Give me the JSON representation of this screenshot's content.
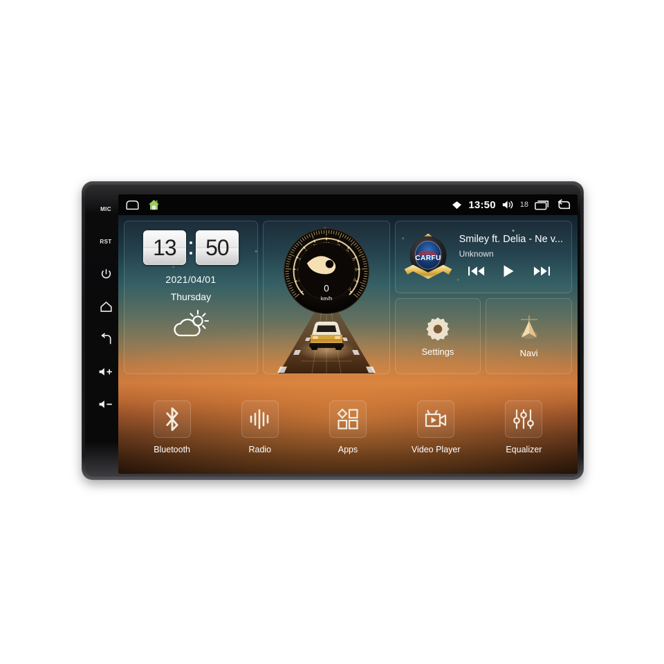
{
  "device": {
    "hard_keys": [
      {
        "name": "mic-key",
        "label": "MIC",
        "type": "text"
      },
      {
        "name": "reset-key",
        "label": "RST",
        "type": "text"
      },
      {
        "name": "power-key",
        "label": "power-icon",
        "type": "icon"
      },
      {
        "name": "home-key",
        "label": "home-icon",
        "type": "icon"
      },
      {
        "name": "back-key",
        "label": "back-icon",
        "type": "icon"
      },
      {
        "name": "volume-up-key",
        "label": "volume-up-icon",
        "type": "icon"
      },
      {
        "name": "volume-down-key",
        "label": "volume-down-icon",
        "type": "icon"
      }
    ]
  },
  "statusbar": {
    "left_icons": [
      "back-outline-icon",
      "home-house-icon"
    ],
    "signal_icon": "wifi-signal-icon",
    "time": "13:50",
    "volume_icon": "volume-icon",
    "volume_value": "18",
    "recents_icon": "recents-icon",
    "back_icon": "back-arrow-icon"
  },
  "clock_widget": {
    "hours": "13",
    "minutes": "50",
    "date": "2021/04/01",
    "weekday": "Thursday",
    "weather_icon": "partly-cloudy-icon"
  },
  "speedometer": {
    "value": "0",
    "unit": "km/h",
    "ticks": [
      "0",
      "20",
      "40",
      "60",
      "80",
      "100",
      "120",
      "140",
      "160",
      "180",
      "200",
      "220",
      "240"
    ],
    "min": 0,
    "max": 240
  },
  "music": {
    "album_art": "carfu-logo",
    "album_art_text": "CARFU",
    "title": "Smiley ft. Delia - Ne v...",
    "artist": "Unknown",
    "prev_icon": "previous-track-icon",
    "play_icon": "play-icon",
    "next_icon": "next-track-icon"
  },
  "tiles": [
    {
      "label": "Settings",
      "icon": "gear-icon",
      "name": "settings"
    },
    {
      "label": "Navi",
      "icon": "navigation-arrow-icon",
      "name": "navi"
    }
  ],
  "dock": [
    {
      "label": "Bluetooth",
      "icon": "bluetooth-icon",
      "name": "bluetooth"
    },
    {
      "label": "Radio",
      "icon": "radio-waveform-icon",
      "name": "radio"
    },
    {
      "label": "Apps",
      "icon": "apps-grid-icon",
      "name": "apps"
    },
    {
      "label": "Video Player",
      "icon": "video-camera-icon",
      "name": "video-player"
    },
    {
      "label": "Equalizer",
      "icon": "equalizer-sliders-icon",
      "name": "equalizer"
    }
  ],
  "colors": {
    "accent_gold": "#e8c684",
    "screen_black": "#050505",
    "text_white": "#ffffff",
    "sky_top": "#12212b",
    "horizon_orange": "#c9763c"
  }
}
